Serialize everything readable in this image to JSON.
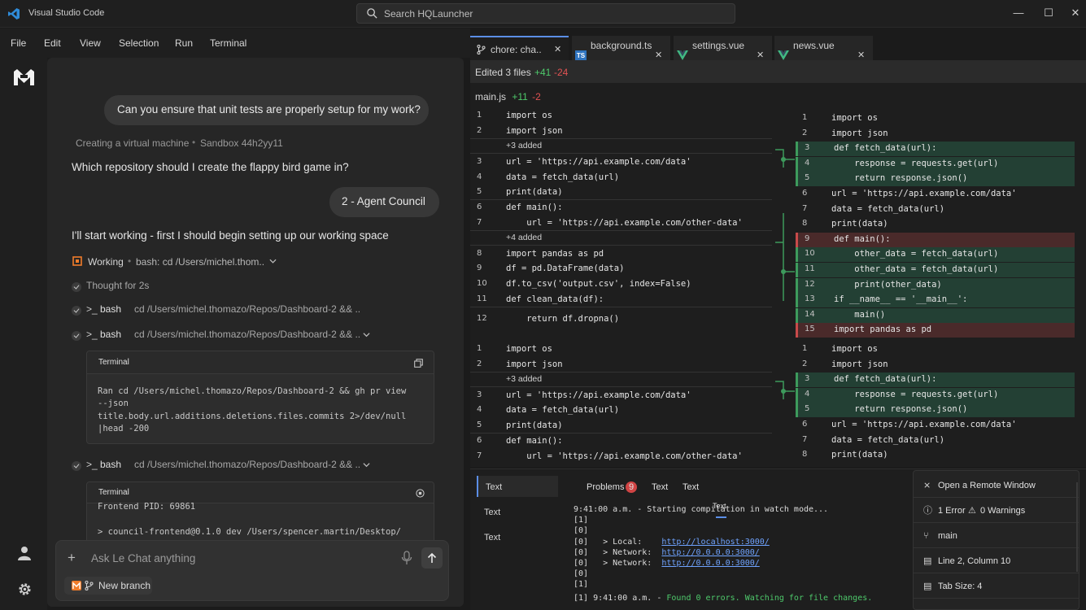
{
  "titlebar": {
    "app_title": "Visual Studio Code",
    "search_placeholder": "Search HQLauncher",
    "minimize": "—",
    "maximize": "☐",
    "close": "✕"
  },
  "menu": [
    "File",
    "Edit",
    "View",
    "Selection",
    "Run",
    "Terminal"
  ],
  "chat": {
    "user_msg_1": "Can you ensure that unit tests are properly setup for my work?",
    "vm_status": "Creating a virtual machine",
    "sandbox": "Sandbox 44h2yy11",
    "question": "Which repository should I create the flappy bird game in?",
    "user_msg_2": "2 - Agent Council",
    "start_msg": "I'll start working - first I should begin setting up our working space",
    "working_label": "Working",
    "working_cmd": "bash: cd /Users/michel.thom..",
    "thought": "Thought for 2s",
    "steps": [
      {
        "label": "bash",
        "cmd": "cd /Users/michel.thomazo/Repos/Dashboard-2 && .."
      },
      {
        "label": "bash",
        "cmd": "cd /Users/michel.thomazo/Repos/Dashboard-2 && .."
      },
      {
        "label": "bash",
        "cmd": "cd /Users/michel.thomazo/Repos/Dashboard-2 && .."
      }
    ],
    "terminal1": {
      "title": "Terminal",
      "lines": [
        "Ran cd /Users/michel.thomazo/Repos/Dashboard-2 && gh pr view",
        "--json",
        "title.body.url.additions.deletions.files.commits 2>/dev/null",
        "|head -200"
      ]
    },
    "terminal2": {
      "title": "Terminal",
      "lines": [
        "Frontend PID: 69861",
        "",
        "> council-frontend@0.1.0 dev /Users/spencer.martin/Desktop/"
      ]
    },
    "composer_placeholder": "Ask Le Chat anything",
    "new_branch": "New branch"
  },
  "editor": {
    "tabs": [
      {
        "label": "chore: cha..",
        "close": "✕"
      },
      {
        "label": "background.ts",
        "close": "✕"
      },
      {
        "label": "settings.vue",
        "close": "✕"
      },
      {
        "label": "news.vue",
        "close": "✕"
      }
    ],
    "ts_badge": "TS",
    "edited": {
      "label": "Edited 3 files",
      "added": "+41",
      "removed": "-24"
    },
    "file": {
      "name": "main.js",
      "added": "+11",
      "removed": "-2"
    },
    "left_top": [
      {
        "n": "1",
        "c": "import os"
      },
      {
        "n": "2",
        "c": "import json"
      },
      {
        "n": "",
        "c": "+3 added",
        "info": true
      },
      {
        "n": "3",
        "c": "url = 'https://api.example.com/data'"
      },
      {
        "n": "4",
        "c": "data = fetch_data(url)"
      },
      {
        "n": "5",
        "c": "print(data)"
      },
      {
        "n": "6",
        "c": "def main():"
      },
      {
        "n": "7",
        "c": "    url = 'https://api.example.com/other-data'"
      },
      {
        "n": "",
        "c": "+4 added",
        "info": true
      },
      {
        "n": "8",
        "c": "import pandas as pd"
      },
      {
        "n": "9",
        "c": "df = pd.DataFrame(data)"
      },
      {
        "n": "10",
        "c": "df.to_csv('output.csv', index=False)"
      },
      {
        "n": "11",
        "c": "def clean_data(df):"
      },
      {
        "n": "12",
        "c": "    return df.dropna()"
      }
    ],
    "right_top": [
      {
        "n": "1",
        "c": "import os"
      },
      {
        "n": "2",
        "c": "import json"
      },
      {
        "n": "3",
        "c": "def fetch_data(url):"
      },
      {
        "n": "4",
        "c": "    response = requests.get(url)"
      },
      {
        "n": "5",
        "c": "    return response.json()"
      },
      {
        "n": "6",
        "c": "url = 'https://api.example.com/data'"
      },
      {
        "n": "7",
        "c": "data = fetch_data(url)"
      },
      {
        "n": "8",
        "c": "print(data)"
      },
      {
        "n": "9",
        "c": "def main():"
      },
      {
        "n": "10",
        "c": "    other_data = fetch_data(url)"
      },
      {
        "n": "11",
        "c": "    other_data = fetch_data(url)"
      },
      {
        "n": "12",
        "c": "    print(other_data)"
      },
      {
        "n": "13",
        "c": "if __name__ == '__main__':"
      },
      {
        "n": "14",
        "c": "    main()"
      },
      {
        "n": "15",
        "c": "import pandas as pd"
      }
    ],
    "left_bottom": [
      {
        "n": "1",
        "c": "import os"
      },
      {
        "n": "2",
        "c": "import json"
      },
      {
        "n": "",
        "c": "+3 added",
        "info": true
      },
      {
        "n": "3",
        "c": "url = 'https://api.example.com/data'"
      },
      {
        "n": "4",
        "c": "data = fetch_data(url)"
      },
      {
        "n": "5",
        "c": "print(data)"
      },
      {
        "n": "6",
        "c": "def main():"
      },
      {
        "n": "7",
        "c": "    url = 'https://api.example.com/other-data'"
      }
    ],
    "right_bottom": [
      {
        "n": "1",
        "c": "import os"
      },
      {
        "n": "2",
        "c": "import json"
      },
      {
        "n": "3",
        "c": "def fetch_data(url):"
      },
      {
        "n": "4",
        "c": "    response = requests.get(url)"
      },
      {
        "n": "5",
        "c": "    return response.json()"
      },
      {
        "n": "6",
        "c": "url = 'https://api.example.com/data'"
      },
      {
        "n": "7",
        "c": "data = fetch_data(url)"
      },
      {
        "n": "8",
        "c": "print(data)"
      }
    ]
  },
  "panel": {
    "side": [
      "Text",
      "Text",
      "Text"
    ],
    "tabs": {
      "problems": "Problems",
      "problems_count": "9",
      "t1": "Text",
      "t2": "Text",
      "t3": "Text"
    },
    "terminal": [
      {
        "pre": "9:41:00 a.m. - Starting compilation in watch mode...",
        "link": "",
        "ok": ""
      },
      {
        "pre": "[1]",
        "link": "",
        "ok": ""
      },
      {
        "pre": "[0]",
        "link": "",
        "ok": ""
      },
      {
        "pre": "[0]   > Local:    ",
        "link": "http://localhost:3000/",
        "ok": ""
      },
      {
        "pre": "[0]   > Network:  ",
        "link": "http://0.0.0.0:3000/",
        "ok": ""
      },
      {
        "pre": "[0]   > Network:  ",
        "link": "http://0.0.0.0:3000/",
        "ok": ""
      },
      {
        "pre": "[0]",
        "link": "",
        "ok": ""
      },
      {
        "pre": "[1]",
        "link": "",
        "ok": ""
      },
      {
        "pre": "[1] 9:41:00 a.m. - ",
        "link": "",
        "ok": "Found 0 errors. Watching for file changes."
      }
    ]
  },
  "status_popup": {
    "remote": "Open a Remote Window",
    "errors": "1 Error",
    "warnings": "0 Warnings",
    "branch": "main",
    "position": "Line 2, Column 10",
    "tabsize": "Tab Size: 4"
  },
  "colors": {
    "accent": "#5b8ee6",
    "added": "#4ec96b",
    "removed": "#e05252",
    "vscode_blue": "#2f8bd8"
  }
}
